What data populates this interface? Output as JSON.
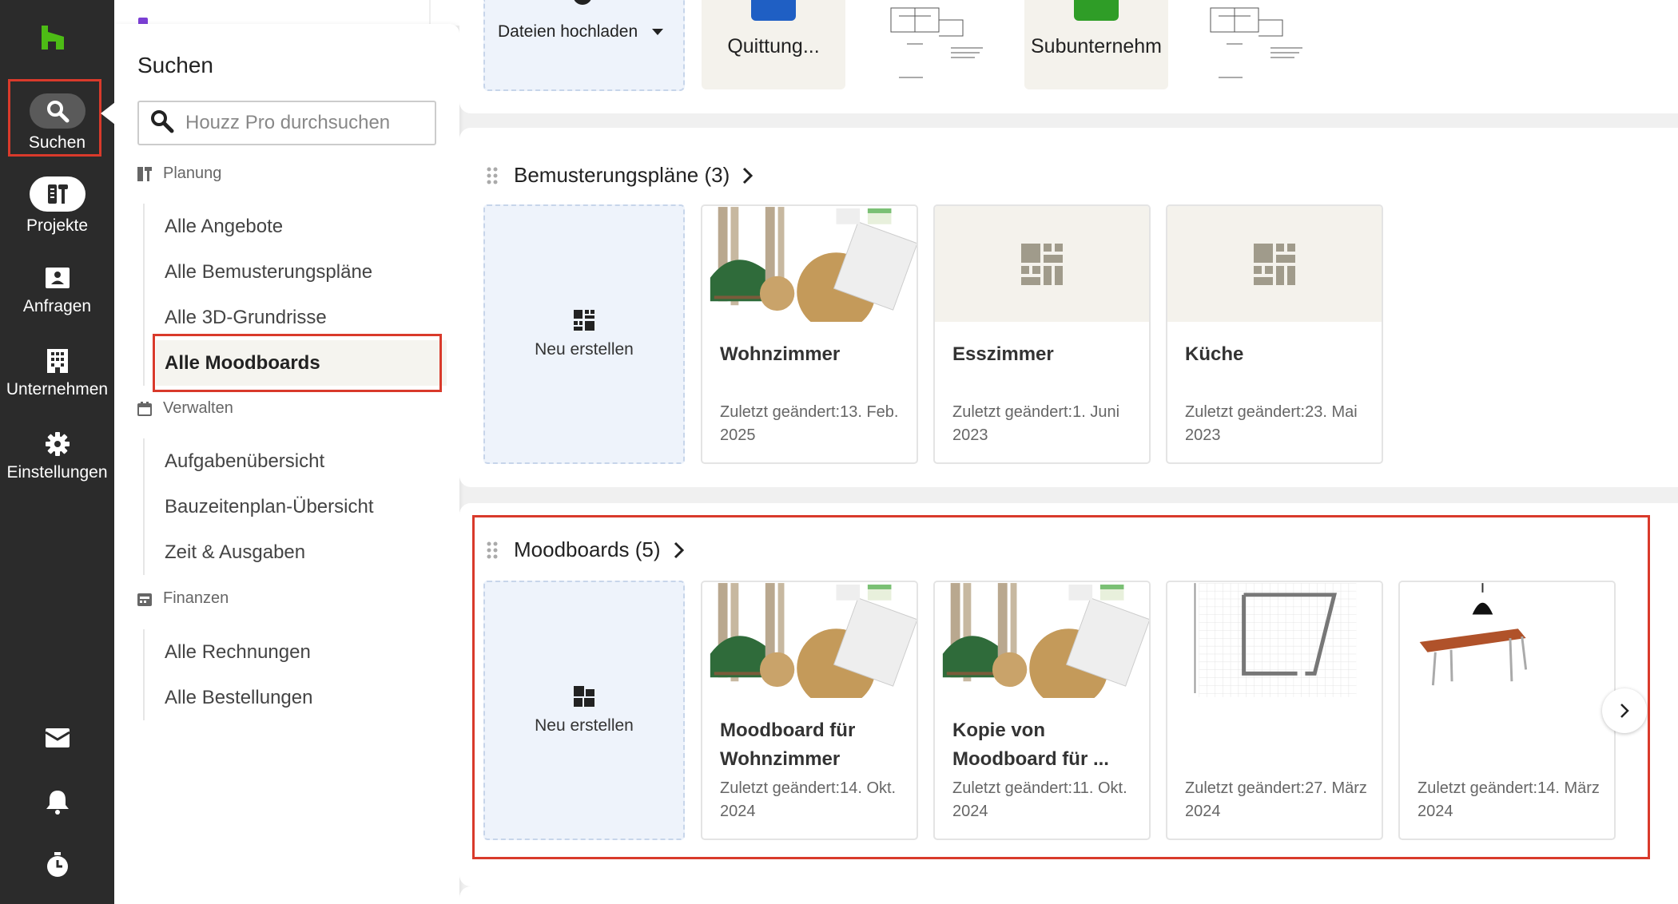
{
  "rail": {
    "items": [
      {
        "label": "Suchen",
        "icon": "search-icon"
      },
      {
        "label": "Projekte",
        "icon": "projects-icon"
      },
      {
        "label": "Anfragen",
        "icon": "inbox-card-icon"
      },
      {
        "label": "Unternehmen",
        "icon": "building-icon"
      },
      {
        "label": "Einstellungen",
        "icon": "gear-icon"
      }
    ],
    "bottom_icons": [
      "mail-icon",
      "bell-icon",
      "timer-icon"
    ]
  },
  "panel": {
    "title": "Suchen",
    "search_placeholder": "Houzz Pro durchsuchen",
    "sections": [
      {
        "title": "Planung",
        "items": [
          "Alle Angebote",
          "Alle Bemusterungspläne",
          "Alle 3D-Grundrisse",
          "Alle Moodboards"
        ]
      },
      {
        "title": "Verwalten",
        "items": [
          "Aufgabenübersicht",
          "Bauzeitenplan-Übersicht",
          "Zeit & Ausgaben"
        ]
      },
      {
        "title": "Finanzen",
        "items": [
          "Alle Rechnungen",
          "Alle Bestellungen"
        ]
      }
    ],
    "active_item": "Alle Moodboards"
  },
  "files": {
    "upload_label": "Dateien hochladen",
    "tiles": [
      "Quittung...",
      "Subunternehm"
    ]
  },
  "selection_plans": {
    "title": "Bemusterungspläne (3)",
    "create_label": "Neu erstellen",
    "cards": [
      {
        "name": "Wohnzimmer",
        "date": "Zuletzt geändert:13. Feb. 2025"
      },
      {
        "name": "Esszimmer",
        "date": "Zuletzt geändert:1. Juni 2023"
      },
      {
        "name": "Küche",
        "date": "Zuletzt geändert:23. Mai 2023"
      }
    ]
  },
  "moodboards": {
    "title": "Moodboards (5)",
    "create_label": "Neu erstellen",
    "cards": [
      {
        "name": "Moodboard für Wohnzimmer",
        "date": "Zuletzt geändert:14. Okt. 2024"
      },
      {
        "name": "Kopie von Moodboard für ...",
        "date": "Zuletzt geändert:11. Okt. 2024"
      },
      {
        "name": "",
        "date": "Zuletzt geändert:27. März 2024"
      },
      {
        "name": "",
        "date": "Zuletzt geändert:14. März 2024"
      }
    ]
  },
  "colors": {
    "highlight": "#d93a2b",
    "houzz_green": "#4dbc15",
    "rail_bg": "#2b2b2b",
    "create_bg": "#eef3fb"
  }
}
